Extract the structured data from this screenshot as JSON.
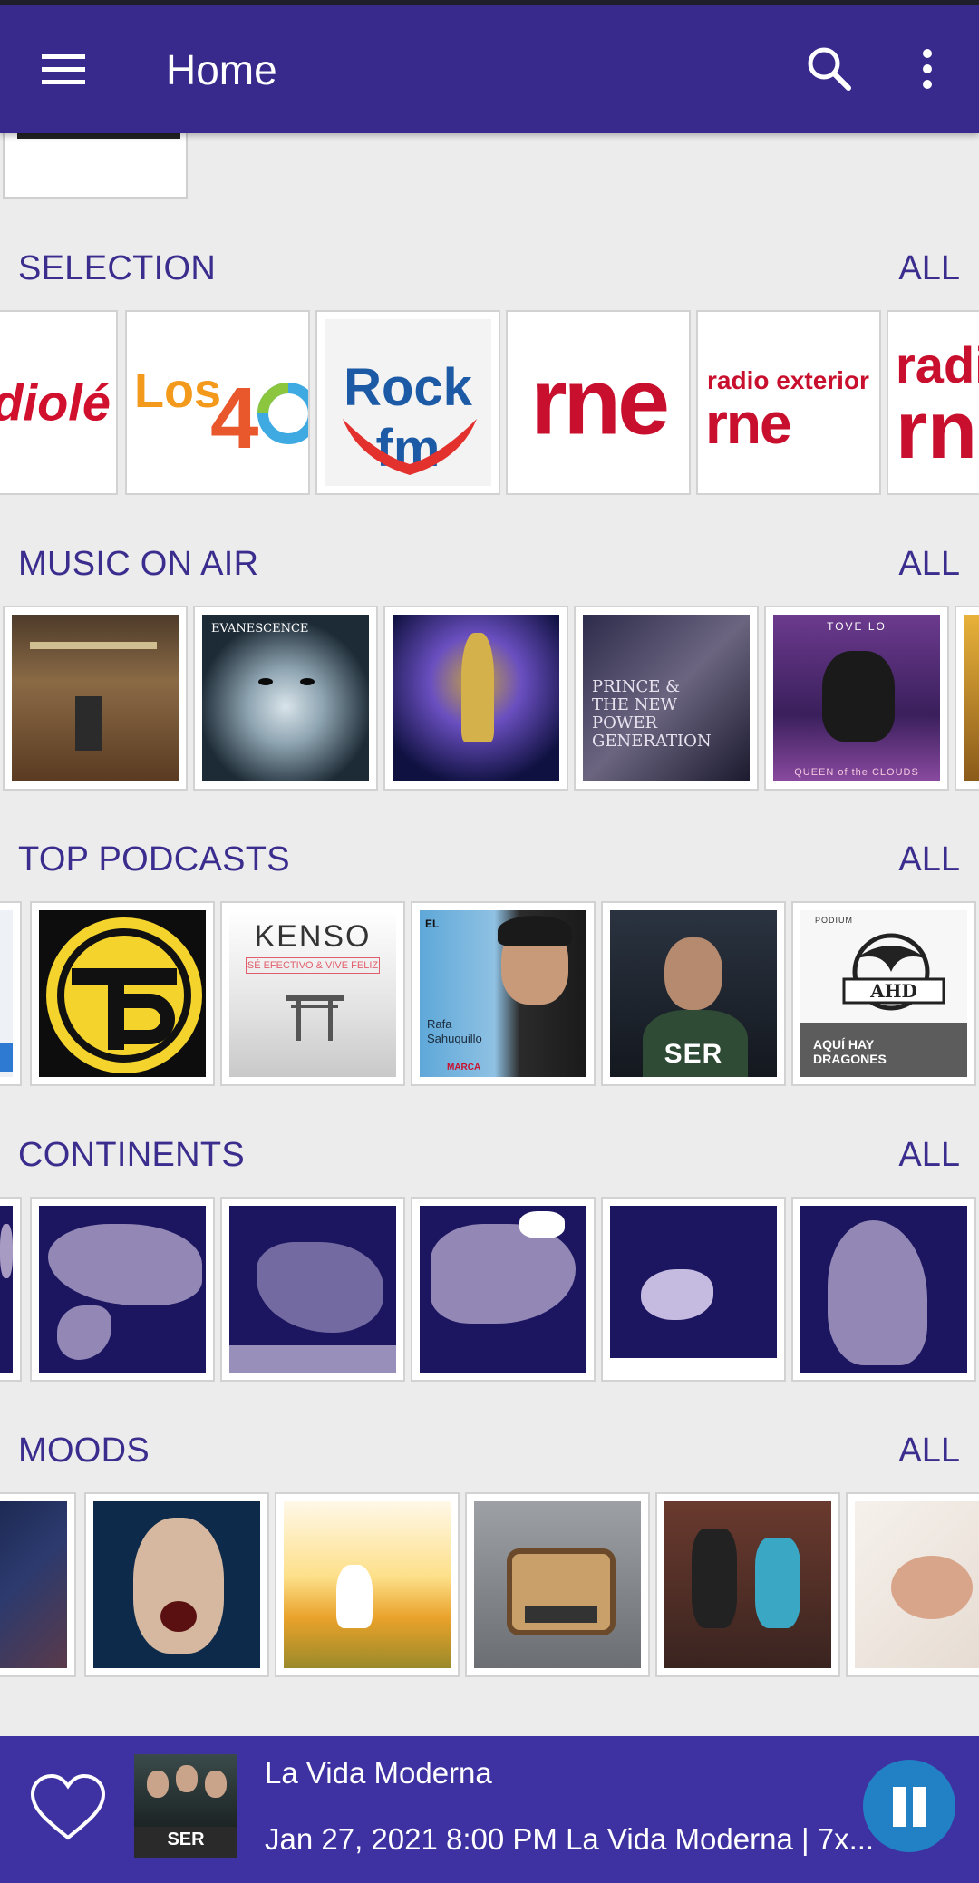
{
  "appbar": {
    "title": "Home"
  },
  "sections": [
    {
      "title": "SELECTION",
      "all_label": "ALL"
    },
    {
      "title": "MUSIC ON AIR",
      "all_label": "ALL"
    },
    {
      "title": "TOP PODCASTS",
      "all_label": "ALL"
    },
    {
      "title": "CONTINENTS",
      "all_label": "ALL"
    },
    {
      "title": "MOODS",
      "all_label": "ALL"
    }
  ],
  "selection_logos": [
    "diolé",
    "LOS 40",
    "Rock fm",
    "rne",
    "radio exterior rne",
    "radi rn"
  ],
  "podcast_texts": {
    "kenso": "KENSO",
    "kenso_sub": "SÉ EFECTIVO & VIVE FELIZ",
    "rafa": "Rafa Sahuquillo",
    "el": "EL",
    "marca": "MARCA",
    "ser": "SER",
    "podium": "PODIUM",
    "ahd": "AHD",
    "dragones": "AQUÍ HAY DRAGONES"
  },
  "album_texts": {
    "evanescence": "EVANESCENCE",
    "prince": "PRINCE & THE NEW POWER GENERATION",
    "tove": "TOVE LO",
    "queen": "QUEEN of the CLOUDS"
  },
  "player": {
    "title": "La Vida Moderna",
    "subtitle": "Jan 27, 2021 8:00 PM La Vida Moderna | 7x...",
    "art_label": "SER"
  },
  "colors": {
    "appbar": "#372a8c",
    "accent_text": "#3a2d8e",
    "player_bg": "#3e31a1",
    "pause_button": "#2281c4"
  }
}
